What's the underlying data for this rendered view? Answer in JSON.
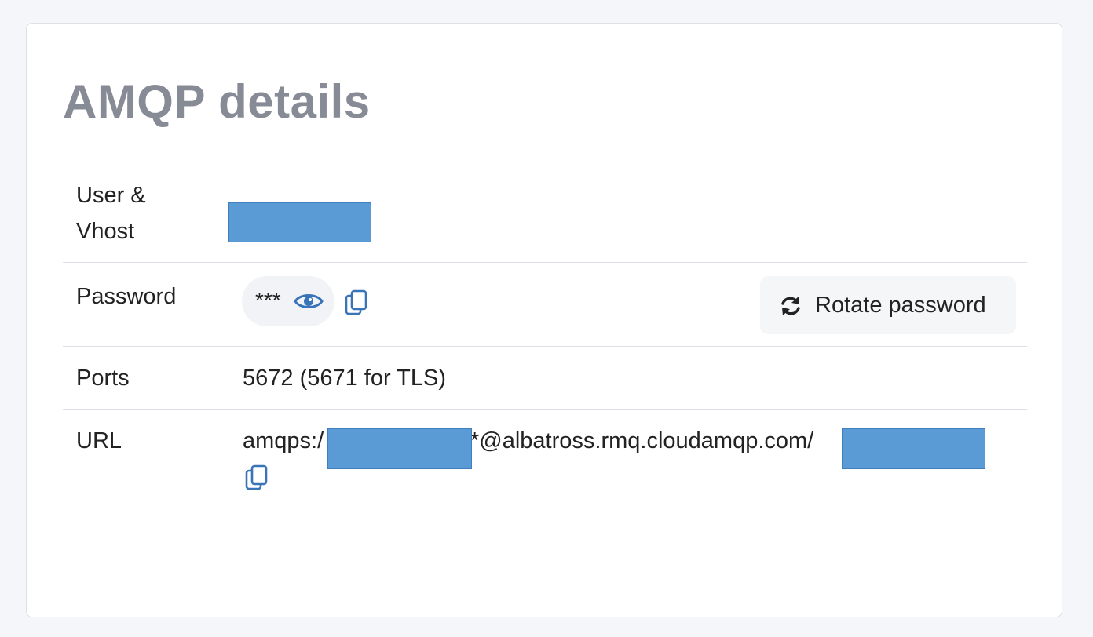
{
  "card": {
    "title": "AMQP details"
  },
  "rows": {
    "user_vhost": {
      "label": "User & Vhost",
      "value_redacted": true
    },
    "password": {
      "label": "Password",
      "mask": "***",
      "reveal_icon": "eye-icon",
      "copy_icon": "copy-icon",
      "rotate_button": {
        "icon": "sync-icon",
        "label": "Rotate password"
      }
    },
    "ports": {
      "label": "Ports",
      "value": "5672 (5671 for TLS)"
    },
    "url": {
      "label": "URL",
      "prefix": "amqps:/",
      "middle": "*@albatross.rmq.cloudamqp.com/",
      "copy_icon": "copy-icon"
    }
  },
  "colors": {
    "page_bg": "#f4f6f9",
    "card_bg": "#ffffff",
    "title": "#878b95",
    "icon_blue": "#3a74b8",
    "redaction": "#5b9bd5"
  }
}
